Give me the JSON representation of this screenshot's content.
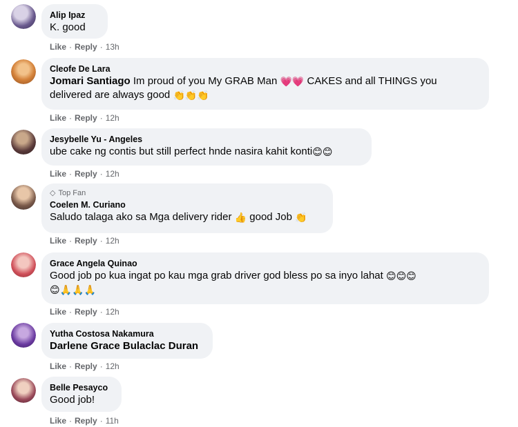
{
  "comments": [
    {
      "author": "Alip Ipaz",
      "text": "K. good",
      "like": "Like",
      "reply": "Reply",
      "time": "13h"
    },
    {
      "author": "Cleofe De Lara",
      "tag": "Jomari Santiago",
      "text": " Im proud of you My GRAB Man ",
      "text2": " CAKES and all THINGS you",
      "line2": "delivered are always good ",
      "emojis1": "💗💗",
      "emojis2": "👏👏👏",
      "like": "Like",
      "reply": "Reply",
      "time": "12h"
    },
    {
      "author": "Jesybelle Yu - Angeles",
      "text": "ube cake ng contis but still perfect hnde nasira kahit konti",
      "emojis": "😊😊",
      "like": "Like",
      "reply": "Reply",
      "time": "12h"
    },
    {
      "badge": "Top Fan",
      "author": "Coelen M. Curiano",
      "text": "Saludo talaga ako sa Mga delivery rider ",
      "emoji1": "👍",
      "text2": " good Job ",
      "emoji2": "👏",
      "like": "Like",
      "reply": "Reply",
      "time": "12h"
    },
    {
      "author": "Grace Angela Quinao",
      "text": "Good job po kua ingat po kau mga grab driver god bless po sa inyo lahat ",
      "emojis": "😊😊😊",
      "line2": "😊🙏🙏🙏",
      "like": "Like",
      "reply": "Reply",
      "time": "12h"
    },
    {
      "author": "Yutha Costosa Nakamura",
      "tag": "Darlene Grace Bulaclac Duran",
      "like": "Like",
      "reply": "Reply",
      "time": "12h"
    },
    {
      "author": "Belle Pesayco",
      "text": "Good job!",
      "like": "Like",
      "reply": "Reply",
      "time": "11h"
    }
  ],
  "icons": {
    "badge": "gem-icon"
  },
  "colors": {
    "bubble": "#f0f2f5",
    "meta": "#65676b",
    "text": "#050505"
  }
}
